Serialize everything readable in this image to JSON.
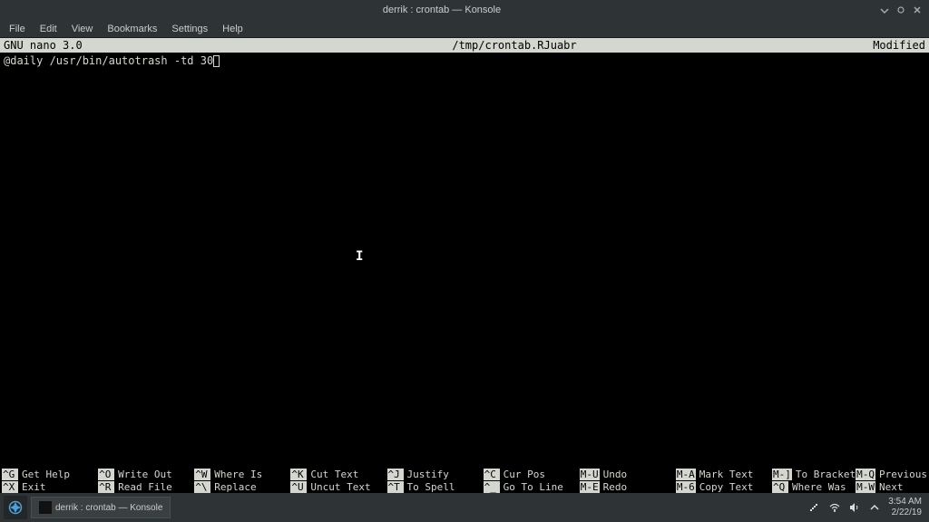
{
  "titlebar": {
    "title": "derrik : crontab — Konsole"
  },
  "menubar": {
    "items": [
      "File",
      "Edit",
      "View",
      "Bookmarks",
      "Settings",
      "Help"
    ]
  },
  "nano": {
    "version": "GNU nano 3.0",
    "filename": "/tmp/crontab.RJuabr",
    "status": "Modified",
    "content": "@daily /usr/bin/autotrash -td 30"
  },
  "shortcuts": [
    {
      "key": "^G",
      "label": "Get Help"
    },
    {
      "key": "^X",
      "label": "Exit"
    },
    {
      "key": "^O",
      "label": "Write Out"
    },
    {
      "key": "^R",
      "label": "Read File"
    },
    {
      "key": "^W",
      "label": "Where Is"
    },
    {
      "key": "^\\",
      "label": "Replace"
    },
    {
      "key": "^K",
      "label": "Cut Text"
    },
    {
      "key": "^U",
      "label": "Uncut Text"
    },
    {
      "key": "^J",
      "label": "Justify"
    },
    {
      "key": "^T",
      "label": "To Spell"
    },
    {
      "key": "^C",
      "label": "Cur Pos"
    },
    {
      "key": "^_",
      "label": "Go To Line"
    },
    {
      "key": "M-U",
      "label": "Undo"
    },
    {
      "key": "M-E",
      "label": "Redo"
    },
    {
      "key": "M-A",
      "label": "Mark Text"
    },
    {
      "key": "M-6",
      "label": "Copy Text"
    },
    {
      "key": "M-]",
      "label": "To Bracket"
    },
    {
      "key": "^Q",
      "label": "Where Was"
    },
    {
      "key": "M-Q",
      "label": "Previous"
    },
    {
      "key": "M-W",
      "label": "Next"
    }
  ],
  "taskbar": {
    "task_label": "derrik : crontab — Konsole",
    "time": "3:54 AM",
    "date": "2/22/19"
  }
}
